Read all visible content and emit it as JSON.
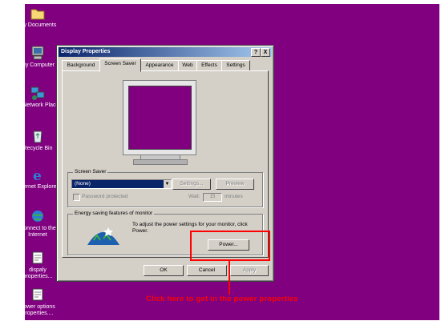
{
  "desktop": {
    "icons": [
      {
        "name": "folder-icon",
        "label": "My Documents"
      },
      {
        "name": "computer-icon",
        "label": "My Computer"
      },
      {
        "name": "network-icon",
        "label": "My Network Places"
      },
      {
        "name": "recycle-bin-icon",
        "label": "Recycle Bin"
      },
      {
        "name": "ie-icon",
        "label": "Internet Explorer"
      },
      {
        "name": "connect-icon",
        "label": "Connect to the Internet"
      },
      {
        "name": "shortcut-icon",
        "label": "dispaly properties..."
      },
      {
        "name": "shortcut-icon",
        "label": "power options properties...."
      }
    ],
    "background_color": "#800080"
  },
  "dialog": {
    "title": "Display Properties",
    "help_btn": "?",
    "close_btn": "X",
    "tabs": [
      "Background",
      "Screen Saver",
      "Appearance",
      "Web",
      "Effects",
      "Settings"
    ],
    "active_tab": "Screen Saver",
    "screen_saver": {
      "group_label": "Screen Saver",
      "selected": "(None)",
      "settings_btn": "Settings...",
      "preview_btn": "Preview",
      "password_label": "Password protected",
      "wait_label": "Wait:",
      "wait_value": "15",
      "minutes_label": "minutes"
    },
    "energy": {
      "group_label": "Energy saving features of monitor",
      "description": "To adjust the power settings for your monitor, click Power.",
      "power_btn": "Power..."
    },
    "buttons": {
      "ok": "OK",
      "cancel": "Cancel",
      "apply": "Apply"
    }
  },
  "annotation": {
    "caption": "Click here to get in the power properties",
    "color": "#ff0000"
  }
}
